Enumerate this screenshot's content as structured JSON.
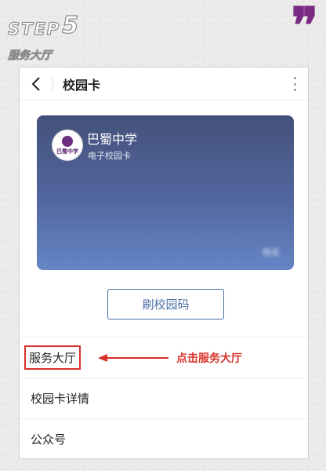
{
  "step": {
    "word": "STEP",
    "number": "5",
    "subtitle": "服务大厅"
  },
  "app": {
    "title": "校园卡",
    "card": {
      "school_name": "巴蜀中学",
      "card_type": "电子校园卡",
      "logo_text": "巴蜀中学",
      "holder_name": "姓名"
    },
    "scan_button": "刷校园码",
    "menu": [
      {
        "label": "服务大厅"
      },
      {
        "label": "校园卡详情"
      },
      {
        "label": "公众号"
      }
    ],
    "annotation": "点击服务大厅"
  },
  "colors": {
    "accent": "#4a6fa5",
    "highlight": "#d9302a",
    "quote": "#7a2a82",
    "card_top": "#44517a",
    "card_bottom": "#6585c5"
  },
  "icons": [
    "chevron-left-icon",
    "more-vertical-icon",
    "quote-icon",
    "arrow-left-icon"
  ]
}
